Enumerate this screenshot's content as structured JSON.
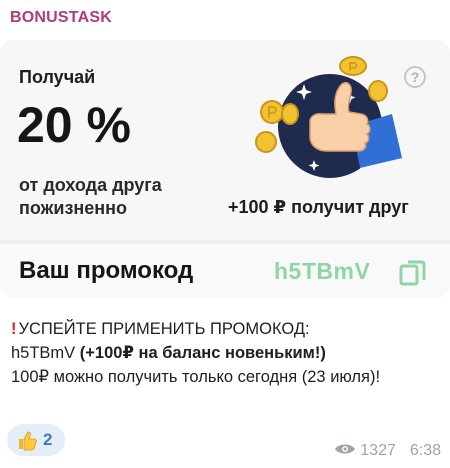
{
  "sender": "BONUSTASK",
  "card": {
    "get_label": "Получай",
    "percent": "20 %",
    "description": "от дохода друга пожизненно",
    "friend_bonus": "+100  ₽ получит друг",
    "promo_label": "Ваш промокод",
    "promo_code": "h5TBmV",
    "promo_color": "#8fd5a6"
  },
  "message": {
    "line1": "УСПЕЙТЕ ПРИМЕНИТЬ ПРОМОКОД:",
    "code": "h5TBmV",
    "bold_part": "(+100₽ на баланс новеньким!)",
    "line3": "100₽ можно получить только сегодня (23 июля)!"
  },
  "reaction": {
    "emoji_icon": "thumbs-up-icon",
    "count": "2"
  },
  "meta": {
    "views": "1327",
    "time": "6:38"
  },
  "colors": {
    "sender": "#b13a78",
    "accent_blue": "#3a7bbf",
    "circle": "#1e2b4d",
    "coin": "#f2c230"
  }
}
